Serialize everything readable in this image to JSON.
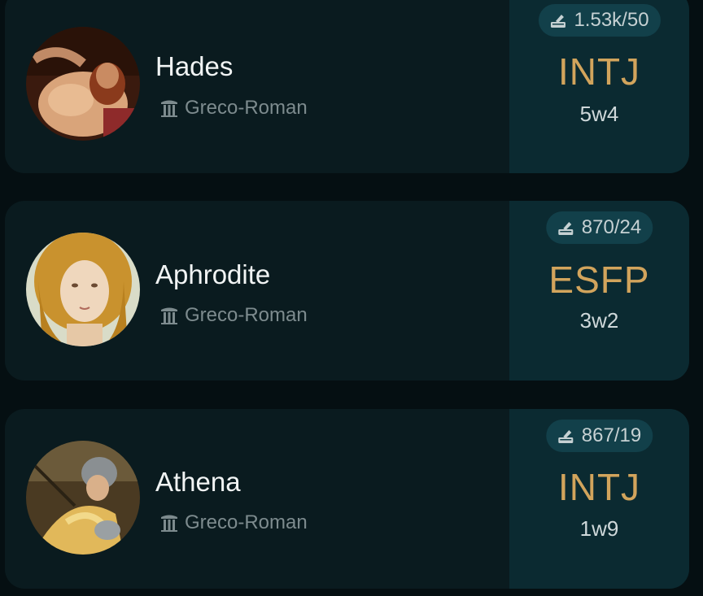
{
  "profiles": [
    {
      "name": "Hades",
      "category": "Greco-Roman",
      "category_icon": "greek-column-icon",
      "votes": "1.53k/50",
      "votes_icon": "vote-ballot-icon",
      "mbti": "INTJ",
      "enneagram": "5w4",
      "avatar_description": "classical-painting-portrait"
    },
    {
      "name": "Aphrodite",
      "category": "Greco-Roman",
      "category_icon": "greek-column-icon",
      "votes": "870/24",
      "votes_icon": "vote-ballot-icon",
      "mbti": "ESFP",
      "enneagram": "3w2",
      "avatar_description": "classical-painting-portrait"
    },
    {
      "name": "Athena",
      "category": "Greco-Roman",
      "category_icon": "greek-column-icon",
      "votes": "867/19",
      "votes_icon": "vote-ballot-icon",
      "mbti": "INTJ",
      "enneagram": "1w9",
      "avatar_description": "classical-painting-portrait"
    }
  ],
  "colors": {
    "background": "#050f12",
    "card": "#0a1b1f",
    "type_panel": "#0b2a31",
    "vote_pill": "#12404a",
    "mbti_gold": "#d2a45c",
    "name_text": "#f1f4f4",
    "muted_text": "#7d8b8e"
  }
}
